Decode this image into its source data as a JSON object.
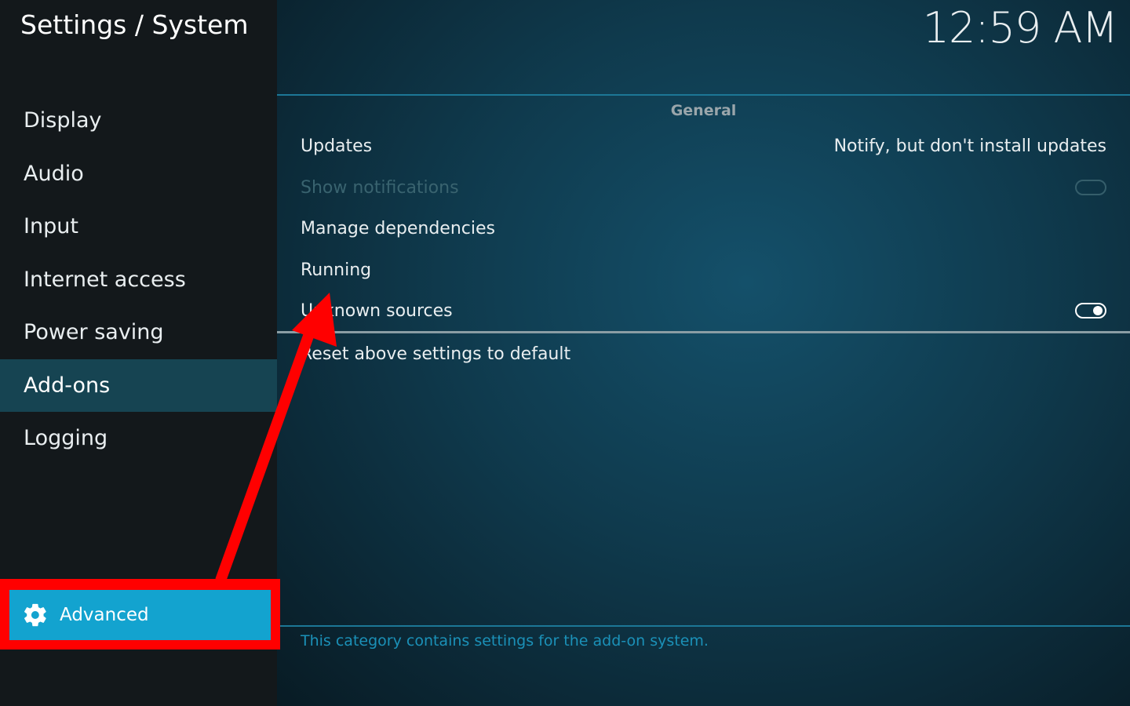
{
  "header": {
    "breadcrumb": "Settings / System",
    "clock": "12:59 AM"
  },
  "sidebar": {
    "items": [
      {
        "label": "Display"
      },
      {
        "label": "Audio"
      },
      {
        "label": "Input"
      },
      {
        "label": "Internet access"
      },
      {
        "label": "Power saving"
      },
      {
        "label": "Add-ons",
        "active": true
      },
      {
        "label": "Logging"
      }
    ],
    "level_button": {
      "label": "Advanced",
      "icon": "gear-icon"
    }
  },
  "main": {
    "group_title": "General",
    "settings": [
      {
        "label": "Updates",
        "value": "Notify, but don't install updates"
      },
      {
        "label": "Show notifications",
        "type": "toggle",
        "state": "off",
        "disabled": true
      },
      {
        "label": "Manage dependencies"
      },
      {
        "label": "Running"
      },
      {
        "label": "Unknown sources",
        "type": "toggle",
        "state": "on"
      }
    ],
    "reset_label": "Reset above settings to default",
    "description": "This category contains settings for the add-on system."
  },
  "colors": {
    "accent": "#13a3cf",
    "active_item": "#164452",
    "annotation": "#ff0000"
  }
}
